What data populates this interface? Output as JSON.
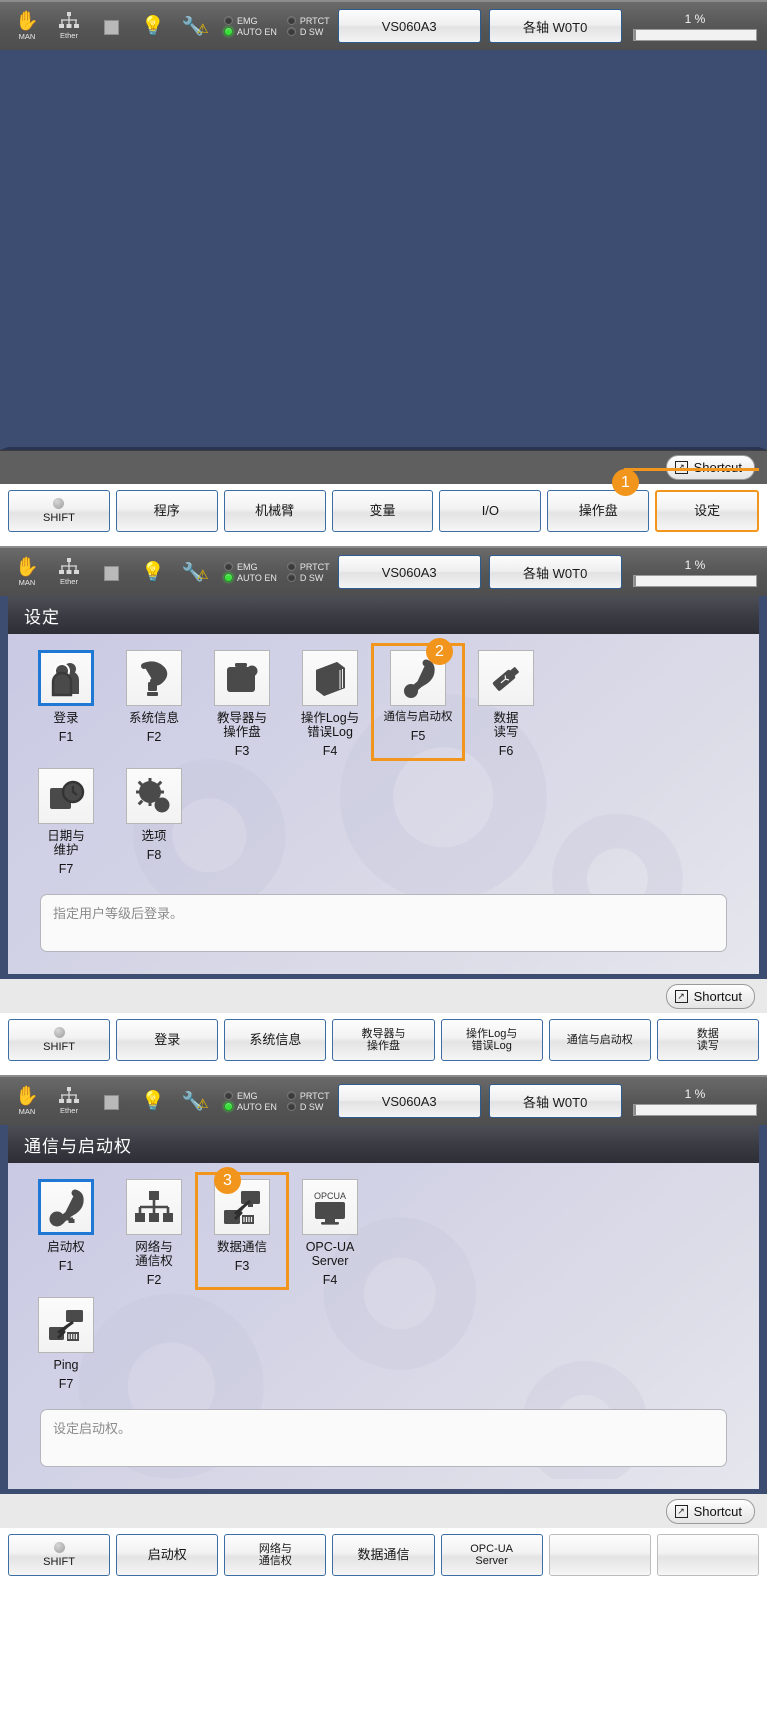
{
  "status": {
    "mode_caption": "MAN",
    "ether_caption": "Ether",
    "lamps": [
      {
        "label": "EMG",
        "on": false
      },
      {
        "label": "PRTCT",
        "on": false
      },
      {
        "label": "AUTO EN",
        "on": true
      },
      {
        "label": "D SW",
        "on": false
      }
    ],
    "model_button": "VS060A3",
    "axis_button": "各轴 W0T0",
    "speed_value": "1 %"
  },
  "shortcut_label": "Shortcut",
  "panel1": {
    "fkeys": [
      {
        "label": "SHIFT",
        "type": "shift"
      },
      {
        "label": "程序"
      },
      {
        "label": "机械臂"
      },
      {
        "label": "变量"
      },
      {
        "label": "I/O"
      },
      {
        "label": "操作盘"
      },
      {
        "label": "设定",
        "highlight": true
      }
    ],
    "badge": "1"
  },
  "panel2": {
    "title": "设定",
    "badge": "2",
    "icons": [
      {
        "label": "登录",
        "fkey": "F1",
        "icon": "users-icon",
        "selected": true
      },
      {
        "label": "系统信息",
        "fkey": "F2",
        "icon": "robot-arm-icon"
      },
      {
        "label": "教导器与\n操作盘",
        "fkey": "F3",
        "icon": "teach-pendant-icon"
      },
      {
        "label": "操作Log与\n错误Log",
        "fkey": "F4",
        "icon": "book-icon"
      },
      {
        "label": "通信与启动权",
        "fkey": "F5",
        "icon": "phone-handset-icon",
        "highlight": true
      },
      {
        "label": "数据\n读写",
        "fkey": "F6",
        "icon": "usb-stick-icon"
      },
      {
        "label": "日期与\n维护",
        "fkey": "F7",
        "icon": "calendar-clock-icon"
      },
      {
        "label": "选项",
        "fkey": "F8",
        "icon": "gears-icon"
      }
    ],
    "note": "指定用户等级后登录。",
    "fkeys": [
      {
        "label": "SHIFT",
        "type": "shift"
      },
      {
        "label": "登录"
      },
      {
        "label": "系统信息"
      },
      {
        "label": "教导器与\n操作盘"
      },
      {
        "label": "操作Log与\n错误Log"
      },
      {
        "label": "通信与启动权"
      },
      {
        "label": "数据\n读写"
      }
    ]
  },
  "panel3": {
    "title": "通信与启动权",
    "badge": "3",
    "icons": [
      {
        "label": "启动权",
        "fkey": "F1",
        "icon": "phone-key-icon",
        "selected": true
      },
      {
        "label": "网络与\n通信权",
        "fkey": "F2",
        "icon": "network-tree-icon"
      },
      {
        "label": "数据通信",
        "fkey": "F3",
        "icon": "data-comm-icon",
        "highlight": true
      },
      {
        "label": "OPC-UA\nServer",
        "fkey": "F4",
        "icon": "opcua-monitor-icon"
      },
      {
        "label": "Ping",
        "fkey": "F7",
        "icon": "ping-icon"
      }
    ],
    "note": "设定启动权。",
    "fkeys": [
      {
        "label": "SHIFT",
        "type": "shift"
      },
      {
        "label": "启动权"
      },
      {
        "label": "网络与\n通信权"
      },
      {
        "label": "数据通信"
      },
      {
        "label": "OPC-UA\nServer"
      },
      {
        "label": ""
      },
      {
        "label": ""
      }
    ]
  },
  "colors": {
    "accent_orange": "#f2951c",
    "select_blue": "#1f79d4",
    "screen_blue": "#3d4c71",
    "statusbar_grey": "#555555"
  }
}
